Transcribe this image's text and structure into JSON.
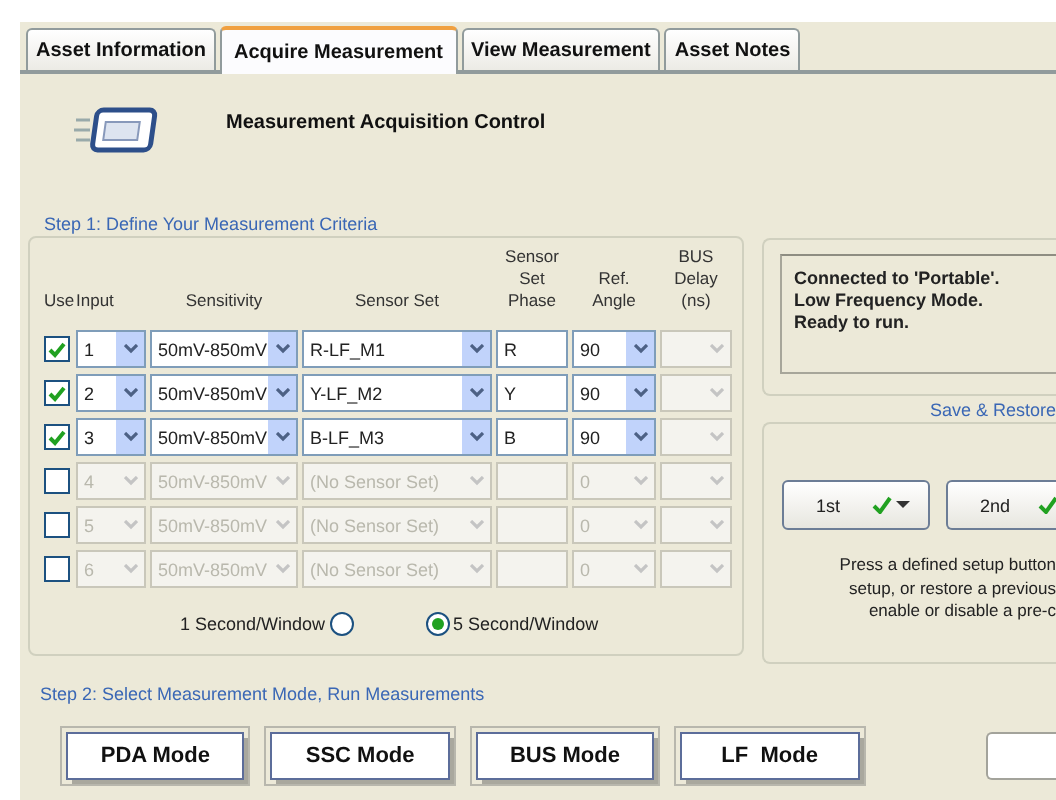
{
  "tabs": [
    {
      "label": "Asset Information",
      "selected": false
    },
    {
      "label": "Acquire Measurement",
      "selected": true
    },
    {
      "label": "View Measurement",
      "selected": false
    },
    {
      "label": "Asset Notes",
      "selected": false
    }
  ],
  "header": {
    "title": "Measurement Acquisition Control"
  },
  "step1": {
    "title": "Step 1:  Define Your Measurement Criteria",
    "columns": [
      "Use",
      "Input",
      "Sensitivity",
      "Sensor Set",
      "Sensor\nSet\nPhase",
      "Ref.\nAngle",
      "BUS\nDelay\n(ns)"
    ],
    "rows": [
      {
        "checked": true,
        "input": "1",
        "sensitivity": "50mV-850mV",
        "sensor_set": "R-LF_M1",
        "phase": "R",
        "ref_angle": "90"
      },
      {
        "checked": true,
        "input": "2",
        "sensitivity": "50mV-850mV",
        "sensor_set": "Y-LF_M2",
        "phase": "Y",
        "ref_angle": "90"
      },
      {
        "checked": true,
        "input": "3",
        "sensitivity": "50mV-850mV",
        "sensor_set": "B-LF_M3",
        "phase": "B",
        "ref_angle": "90"
      },
      {
        "checked": false,
        "input": "4",
        "sensitivity": "50mV-850mV",
        "sensor_set": "(No Sensor Set)",
        "ref_angle": "0"
      },
      {
        "checked": false,
        "input": "5",
        "sensitivity": "50mV-850mV",
        "sensor_set": "(No Sensor Set)",
        "ref_angle": "0"
      },
      {
        "checked": false,
        "input": "6",
        "sensitivity": "50mV-850mV",
        "sensor_set": "(No Sensor Set)",
        "ref_angle": "0"
      }
    ],
    "windows": [
      {
        "label": "1 Second/Window",
        "selected": false
      },
      {
        "label": "5 Second/Window",
        "selected": true
      }
    ]
  },
  "status": {
    "text": "Connected to 'Portable'.\nLow Frequency Mode.\nReady to run."
  },
  "save_restore": {
    "title": "Save & Restore",
    "setups": [
      {
        "label": "1st",
        "checked": true
      },
      {
        "label": "2nd",
        "checked": true
      }
    ],
    "help": "Press a defined setup button\nsetup, or restore a previous\nenable or disable a pre-c"
  },
  "step2": {
    "title": "Step 2:  Select Measurement Mode, Run Measurements",
    "modes": [
      "PDA Mode",
      "SSC Mode",
      "BUS Mode",
      "LF  Mode"
    ]
  }
}
